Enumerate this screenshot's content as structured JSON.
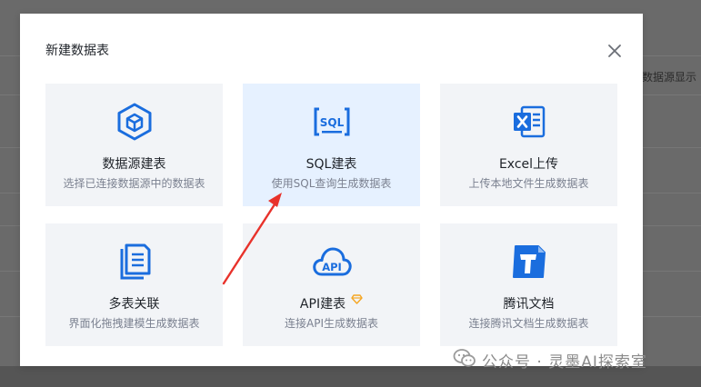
{
  "background": {
    "header_fragment": "数据源显示"
  },
  "dialog": {
    "title": "新建数据表",
    "close_icon": "close-icon",
    "options": [
      {
        "id": "datasource",
        "icon": "cube-hexagon-icon",
        "title": "数据源建表",
        "description": "选择已连接数据源中的数据表",
        "active": false
      },
      {
        "id": "sql",
        "icon": "sql-icon",
        "title": "SQL建表",
        "description": "使用SQL查询生成数据表",
        "active": true
      },
      {
        "id": "excel",
        "icon": "excel-icon",
        "title": "Excel上传",
        "description": "上传本地文件生成数据表",
        "active": false
      },
      {
        "id": "multi",
        "icon": "documents-icon",
        "title": "多表关联",
        "description": "界面化拖拽建模生成数据表",
        "active": false
      },
      {
        "id": "api",
        "icon": "api-cloud-icon",
        "title": "API建表",
        "description": "连接API生成数据表",
        "active": false,
        "badge": "diamond-icon"
      },
      {
        "id": "tencent",
        "icon": "tencent-docs-icon",
        "title": "腾讯文档",
        "description": "连接腾讯文档生成数据表",
        "active": false
      }
    ]
  },
  "colors": {
    "accent": "#1a6dde",
    "card_bg": "#f2f4f7",
    "card_active_bg": "#e6f1ff",
    "arrow": "#e8322b",
    "badge": "#f5a623"
  },
  "watermark": {
    "text": "公众号 · 灵墨AI探索室"
  }
}
